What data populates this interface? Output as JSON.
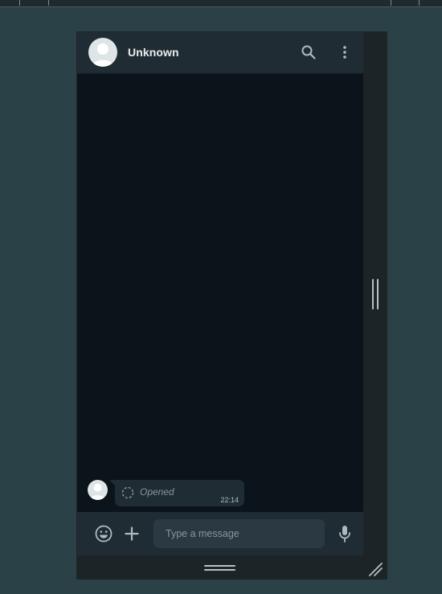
{
  "conversation": {
    "contact_name": "Unknown"
  },
  "messages": [
    {
      "status_text": "Opened",
      "time": "22:14"
    }
  ],
  "composer": {
    "placeholder": "Type a message"
  },
  "colors": {
    "background": "#2a4247",
    "chat_background": "#0b141a",
    "header": "#202c33",
    "bubble": "#202c33",
    "input": "#2a3942",
    "icon": "#aebac1"
  },
  "icons": {
    "header": [
      "search-icon",
      "more-vertical-icon"
    ],
    "composer": [
      "emoji-icon",
      "plus-icon",
      "microphone-icon"
    ],
    "message": [
      "pending-spinner-icon"
    ]
  }
}
